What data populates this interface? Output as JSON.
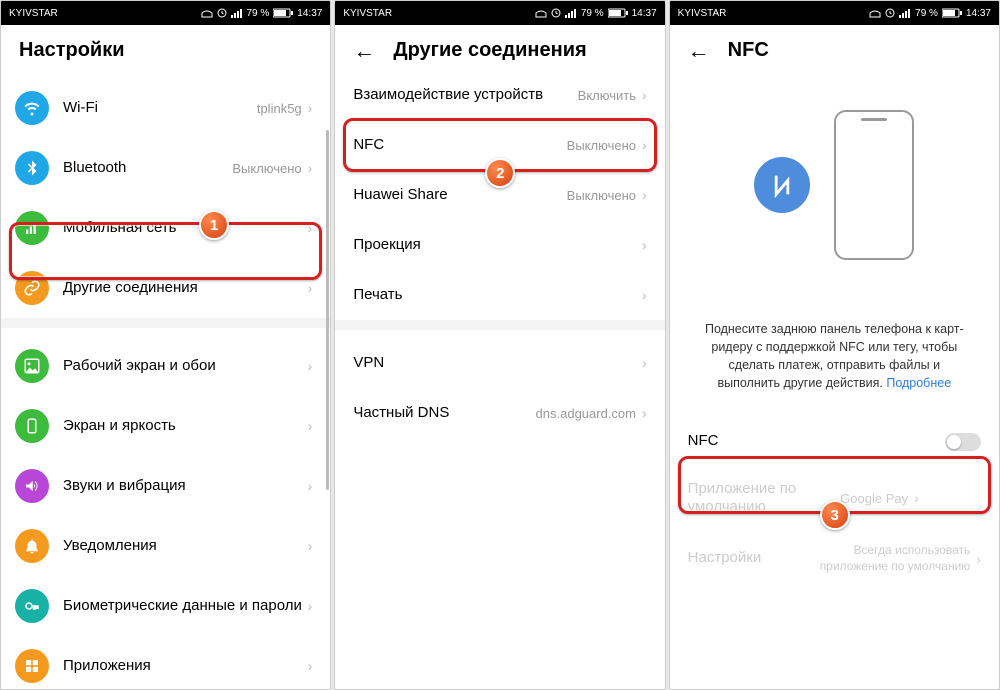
{
  "statusbar": {
    "carrier": "KYIVSTAR",
    "battery": "79 %",
    "time": "14:37"
  },
  "screen1": {
    "title": "Настройки",
    "wifi": {
      "label": "Wi-Fi",
      "value": "tplink5g"
    },
    "bluetooth": {
      "label": "Bluetooth",
      "value": "Выключено"
    },
    "mobile": {
      "label": "Мобильная сеть"
    },
    "other": {
      "label": "Другие соединения"
    },
    "home": {
      "label": "Рабочий экран и обои"
    },
    "display": {
      "label": "Экран и яркость"
    },
    "sound": {
      "label": "Звуки и вибрация"
    },
    "notif": {
      "label": "Уведомления"
    },
    "bio": {
      "label": "Биометрические данные и пароли"
    },
    "apps": {
      "label": "Приложения"
    },
    "badge": "1"
  },
  "screen2": {
    "title": "Другие соединения",
    "deviceconnect": {
      "label": "Взаимодействие устройств",
      "value": "Включить"
    },
    "nfc": {
      "label": "NFC",
      "value": "Выключено"
    },
    "huaweishare": {
      "label": "Huawei Share",
      "value": "Выключено"
    },
    "projection": {
      "label": "Проекция"
    },
    "print": {
      "label": "Печать"
    },
    "vpn": {
      "label": "VPN"
    },
    "dns": {
      "label": "Частный DNS",
      "value": "dns.adguard.com"
    },
    "badge": "2"
  },
  "screen3": {
    "title": "NFC",
    "help": "Поднесите заднюю панель телефона к карт-ридеру с поддержкой NFC или тегу, чтобы сделать платеж, отправить файлы и выполнить другие действия.",
    "more": "Подробнее",
    "nfc_toggle": {
      "label": "NFC"
    },
    "default_app": {
      "label": "Приложение по умолчанию",
      "value": "Google Pay"
    },
    "settings": {
      "label": "Настройки",
      "value": "Всегда использовать приложение по умолчанию"
    },
    "badge": "3"
  }
}
